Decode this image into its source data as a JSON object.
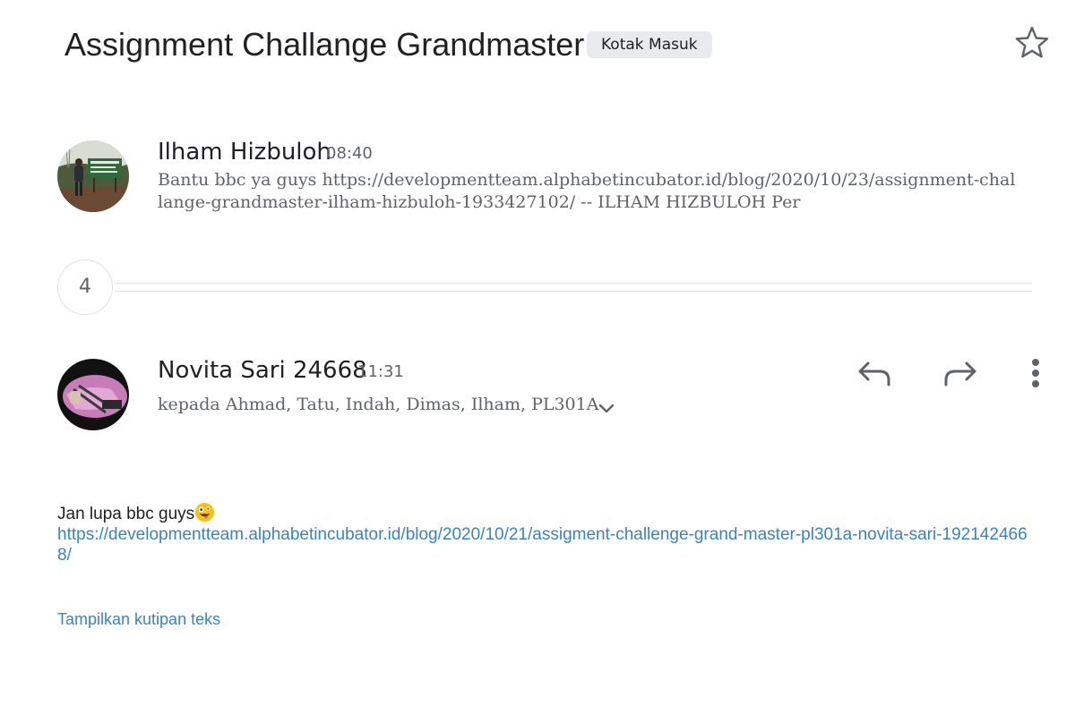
{
  "thread": {
    "subject": "Assignment Challange Grandmaster",
    "label": "Kotak Masuk",
    "star_icon": "star-outline-icon"
  },
  "message_collapsed": {
    "sender": "Ilham Hizbuloh",
    "time": "08:40",
    "snippet": "Bantu bbc ya guys https://developmentteam.alphabetincubator.id/blog/2020/10/23/assignment-challange-grandmaster-ilham-hizbuloh-1933427102/ -- ILHAM HIZBULOH Per"
  },
  "collapsed_count": "4",
  "message_expanded": {
    "sender": "Novita Sari 24668",
    "time": "11:31",
    "recipients": "kepada Ahmad, Tatu, Indah, Dimas, Ilham, PL301A",
    "body_text": "Jan lupa bbc guys",
    "body_emoji": "zany-face-emoji",
    "body_link": "https://developmentteam.alphabetincubator.id/blog/2020/10/21/assigment-challenge-grand-master-pl301a-novita-sari-1921424668/",
    "show_quote": "Tampilkan kutipan teks",
    "actions": {
      "reply_icon": "reply-icon",
      "forward_icon": "forward-icon",
      "more_icon": "more-vert-icon"
    }
  },
  "colors": {
    "link": "#3b82c4",
    "secondary_text": "#5f6368",
    "chip_bg": "#e8eaed"
  }
}
